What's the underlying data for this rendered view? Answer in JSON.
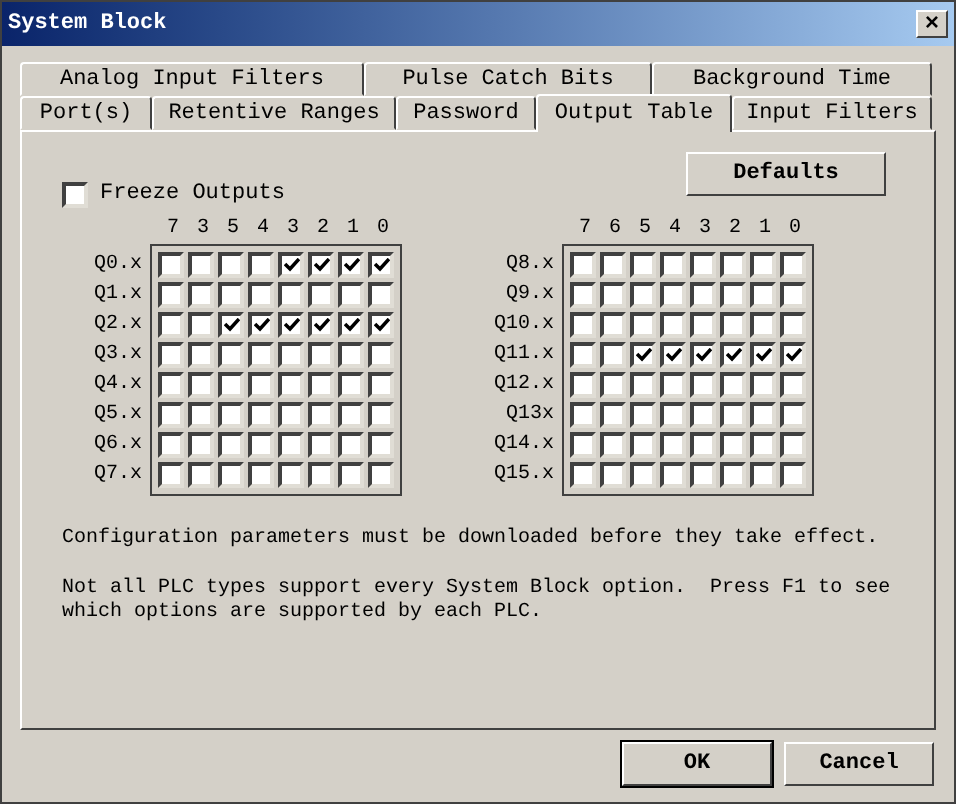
{
  "window": {
    "title": "System Block",
    "close": "×"
  },
  "tab_rows": [
    [
      {
        "label": "Analog Input Filters",
        "selected": false
      },
      {
        "label": "Pulse Catch Bits",
        "selected": false
      },
      {
        "label": "Background Time",
        "selected": false
      }
    ],
    [
      {
        "label": "Port(s)",
        "selected": false
      },
      {
        "label": "Retentive Ranges",
        "selected": false
      },
      {
        "label": "Password",
        "selected": false
      },
      {
        "label": "Output Table",
        "selected": true
      },
      {
        "label": "Input Filters",
        "selected": false
      }
    ]
  ],
  "freeze_outputs": {
    "label": "Freeze Outputs",
    "checked": false
  },
  "defaults_button": "Defaults",
  "tables": [
    {
      "columns": [
        "7",
        "3",
        "5",
        "4",
        "3",
        "2",
        "1",
        "0"
      ],
      "rows": [
        {
          "label": "Q0.x",
          "bits": [
            false,
            false,
            false,
            false,
            true,
            true,
            true,
            true
          ]
        },
        {
          "label": "Q1.x",
          "bits": [
            false,
            false,
            false,
            false,
            false,
            false,
            false,
            false
          ]
        },
        {
          "label": "Q2.x",
          "bits": [
            false,
            false,
            true,
            true,
            true,
            true,
            true,
            true
          ]
        },
        {
          "label": "Q3.x",
          "bits": [
            false,
            false,
            false,
            false,
            false,
            false,
            false,
            false
          ]
        },
        {
          "label": "Q4.x",
          "bits": [
            false,
            false,
            false,
            false,
            false,
            false,
            false,
            false
          ]
        },
        {
          "label": "Q5.x",
          "bits": [
            false,
            false,
            false,
            false,
            false,
            false,
            false,
            false
          ]
        },
        {
          "label": "Q6.x",
          "bits": [
            false,
            false,
            false,
            false,
            false,
            false,
            false,
            false
          ]
        },
        {
          "label": "Q7.x",
          "bits": [
            false,
            false,
            false,
            false,
            false,
            false,
            false,
            false
          ]
        }
      ]
    },
    {
      "columns": [
        "7",
        "6",
        "5",
        "4",
        "3",
        "2",
        "1",
        "0"
      ],
      "rows": [
        {
          "label": "Q8.x",
          "bits": [
            false,
            false,
            false,
            false,
            false,
            false,
            false,
            false
          ]
        },
        {
          "label": "Q9.x",
          "bits": [
            false,
            false,
            false,
            false,
            false,
            false,
            false,
            false
          ]
        },
        {
          "label": "Q10.x",
          "bits": [
            false,
            false,
            false,
            false,
            false,
            false,
            false,
            false
          ]
        },
        {
          "label": "Q11.x",
          "bits": [
            false,
            false,
            true,
            true,
            true,
            true,
            true,
            true
          ]
        },
        {
          "label": "Q12.x",
          "bits": [
            false,
            false,
            false,
            false,
            false,
            false,
            false,
            false
          ]
        },
        {
          "label": "Q13x",
          "bits": [
            false,
            false,
            false,
            false,
            false,
            false,
            false,
            false
          ]
        },
        {
          "label": "Q14.x",
          "bits": [
            false,
            false,
            false,
            false,
            false,
            false,
            false,
            false
          ]
        },
        {
          "label": "Q15.x",
          "bits": [
            false,
            false,
            false,
            false,
            false,
            false,
            false,
            false
          ]
        }
      ]
    }
  ],
  "notes": [
    "Configuration parameters must be downloaded before they take effect.",
    "Not all PLC types support every System Block option.  Press F1 to see which options are supported by each PLC."
  ],
  "buttons": [
    "OK",
    "Cancel"
  ]
}
